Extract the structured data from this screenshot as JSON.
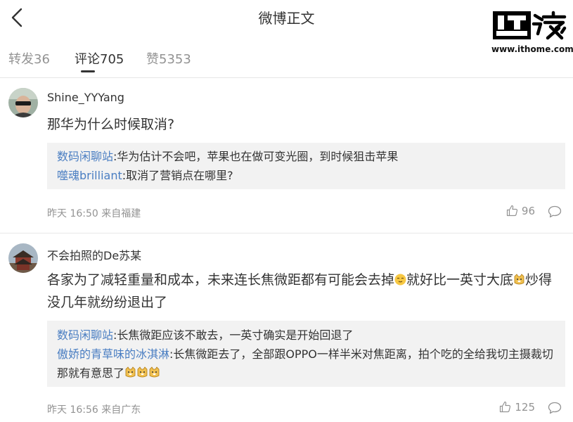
{
  "header": {
    "title": "微博正文",
    "logo_url": "www.ithome.com"
  },
  "tabs": [
    {
      "label": "转发36",
      "active": false
    },
    {
      "label": "评论705",
      "active": true
    },
    {
      "label": "赞5353",
      "active": false
    }
  ],
  "comments": [
    {
      "username": "Shine_YYYang",
      "text": "那华为什么时候取消?",
      "replies": [
        {
          "name": "数码闲聊站",
          "text": ":华为估计不会吧，苹果也在做可变光圈，到时候狙击苹果"
        },
        {
          "name": "噬魂brilliant",
          "text": ":取消了营销点在哪里?"
        }
      ],
      "time": "昨天 16:50",
      "source": "来自福建",
      "likes": "96"
    },
    {
      "username": "不会拍照的De苏某",
      "text_part1": "各家为了减轻重量和成本，未来连长焦微距都有可能会去掉",
      "text_part2": "就好比一英寸大底",
      "text_part3": "炒得没几年就纷纷退出了",
      "replies": [
        {
          "name": "数码闲聊站",
          "text": ":长焦微距应该不敢去，一英寸确实是开始回退了"
        },
        {
          "name": "傲娇的青草味的冰淇淋",
          "text": ":长焦微距去了，全部跟OPPO一样半米对焦距离，拍个吃的全给我切主摄裁切那就有意思了"
        }
      ],
      "time": "昨天 16:56",
      "source": "来自广东",
      "likes": "125"
    }
  ],
  "colors": {
    "reply_name": "#4a7ec2",
    "meta_text": "#939393",
    "reply_bg": "#f2f2f2"
  }
}
